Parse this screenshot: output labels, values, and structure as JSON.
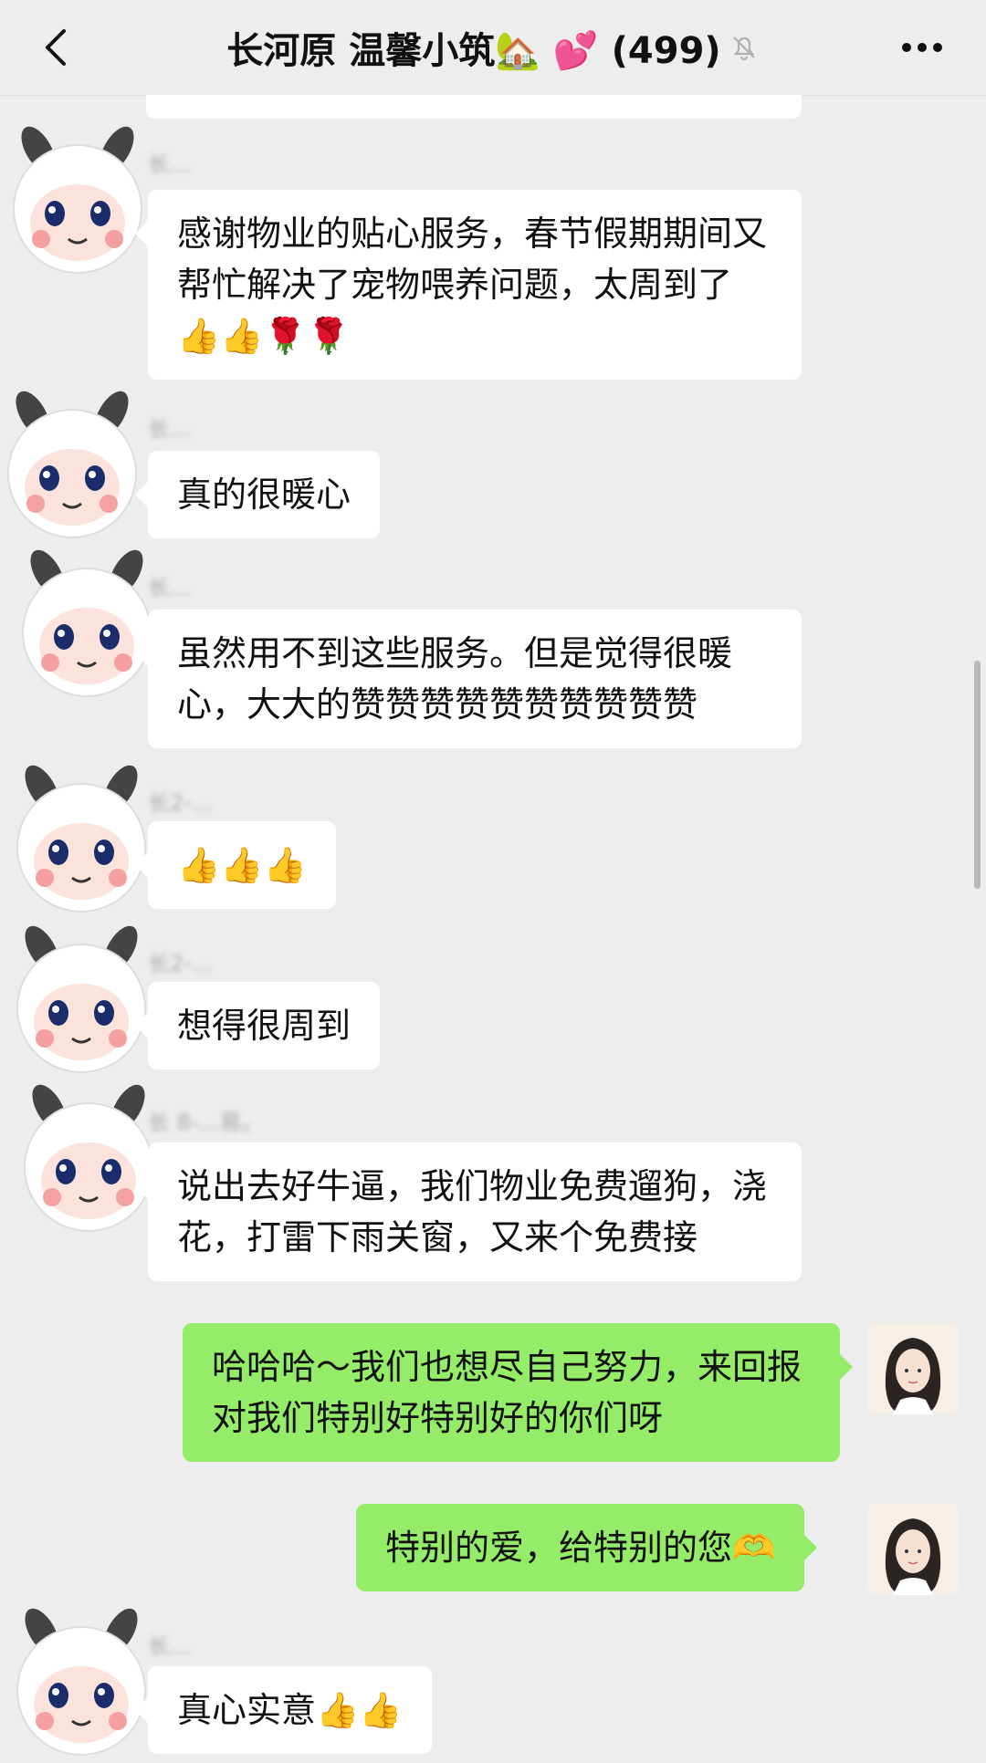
{
  "header": {
    "title": "长河原 温馨小筑🏡 💕 (499)"
  },
  "messages": [
    {
      "text": "感谢物业的贴心服务，春节假期期间又帮忙解决了宠物喂养问题，太周到了👍👍🌹🌹"
    },
    {
      "text": "真的很暖心"
    },
    {
      "text": "虽然用不到这些服务。但是觉得很暖心，大大的赞赞赞赞赞赞赞赞赞赞"
    },
    {
      "text": "👍👍👍"
    },
    {
      "text": "想得很周到"
    },
    {
      "text": "说出去好牛逼，我们物业免费遛狗，浇花，打雷下雨关窗，又来个免费接"
    },
    {
      "text": "哈哈哈～我们也想尽自己努力，来回报对我们特别好特别好的你们呀"
    },
    {
      "text": "特别的爱，给特别的您🫶"
    },
    {
      "text": "真心实意👍👍"
    }
  ],
  "senders": [
    "长...",
    "长...",
    "长...",
    "长2-...",
    "长2-...",
    "长 8-...易。",
    "长..."
  ]
}
